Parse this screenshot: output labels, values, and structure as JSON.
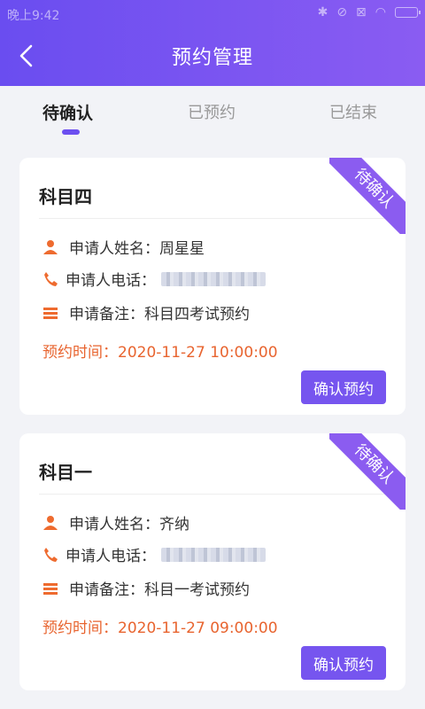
{
  "status_bar": {
    "time": "晚上9:42"
  },
  "header": {
    "title": "预约管理"
  },
  "tabs": [
    {
      "label": "待确认",
      "active": true
    },
    {
      "label": "已预约",
      "active": false
    },
    {
      "label": "已结束",
      "active": false
    }
  ],
  "cards": [
    {
      "subject": "科目四",
      "ribbon": "待确认",
      "name_label": "申请人姓名：",
      "name": "周星星",
      "phone_label": "申请人电话：",
      "note_label": "申请备注：",
      "note": "科目四考试预约",
      "time_label": "预约时间：",
      "time": "2020-11-27 10:00:00",
      "button": "确认预约"
    },
    {
      "subject": "科目一",
      "ribbon": "待确认",
      "name_label": "申请人姓名：",
      "name": "齐纳",
      "phone_label": "申请人电话：",
      "note_label": "申请备注：",
      "note": "科目一考试预约",
      "time_label": "预约时间：",
      "time": "2020-11-27 09:00:00",
      "button": "确认预约"
    }
  ],
  "colors": {
    "accent": "#7655ef",
    "ribbon": "#8b5cf0",
    "icon": "#ee6b2f",
    "time": "#e8642f"
  },
  "icons": [
    "back-arrow-icon",
    "person-icon",
    "phone-icon",
    "note-icon"
  ]
}
